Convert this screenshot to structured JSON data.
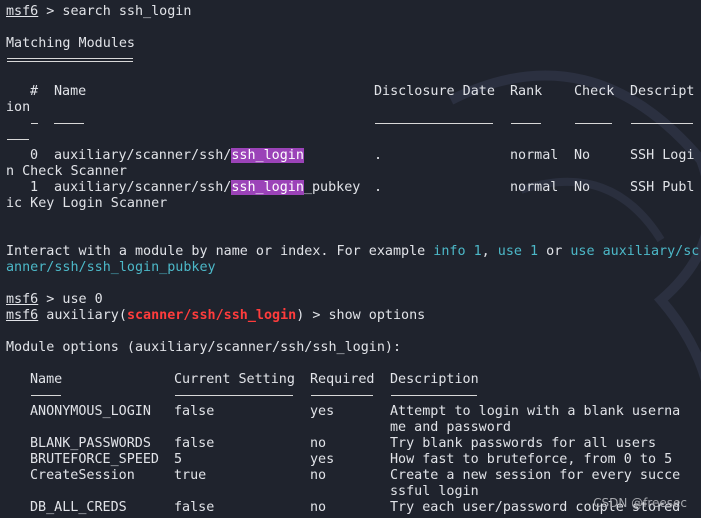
{
  "prompt": "msf6",
  "cmd1": " > search ssh_login",
  "section_matching": "Matching Modules",
  "section_rule": "================",
  "table1": {
    "hdr_idx": "#",
    "hdr_name": "Name",
    "hdr_date": "Disclosure Date",
    "hdr_rank": "Rank",
    "hdr_check": "Check",
    "hdr_desc": "Descript",
    "hdr_desc_wrap": "ion",
    "dash1": "-",
    "dash_wrap": "---",
    "rows": [
      {
        "idx": "0",
        "pre": "auxiliary/scanner/ssh/",
        "hl": "ssh_login",
        "post": "",
        "date": ".",
        "rank": "normal",
        "check": "No",
        "desc": "SSH Logi",
        "desc_wrap": "n Check Scanner"
      },
      {
        "idx": "1",
        "pre": "auxiliary/scanner/ssh/",
        "hl": "ssh_login",
        "post": "_pubkey",
        "date": ".",
        "rank": "normal",
        "check": "No",
        "desc": "SSH Publ",
        "desc_wrap": "ic Key Login Scanner"
      }
    ]
  },
  "interact": {
    "a": "Interact with a module by name or index. For example ",
    "b": "info 1",
    "c": ", ",
    "d": "use 1",
    "e": " or ",
    "f": "use auxiliary/sc",
    "g": "anner/ssh/ssh_login_pubkey"
  },
  "cmd2": " > use 0",
  "prompt_mod_pre": " auxiliary(",
  "prompt_mod_name": "scanner/ssh/ssh_login",
  "prompt_mod_post": ") > show options",
  "options_title": "Module options (auxiliary/scanner/ssh/ssh_login):",
  "table2": {
    "hdr_name": "Name",
    "hdr_setting": "Current Setting",
    "hdr_required": "Required",
    "hdr_desc": "Description",
    "rows": [
      {
        "name": "ANONYMOUS_LOGIN",
        "setting": "false",
        "req": "yes",
        "desc": "Attempt to login with a blank userna",
        "desc2": "me and password"
      },
      {
        "name": "BLANK_PASSWORDS",
        "setting": "false",
        "req": "no",
        "desc": "Try blank passwords for all users",
        "desc2": ""
      },
      {
        "name": "BRUTEFORCE_SPEED",
        "setting": "5",
        "req": "yes",
        "desc": "How fast to bruteforce, from 0 to 5",
        "desc2": ""
      },
      {
        "name": "CreateSession",
        "setting": "true",
        "req": "no",
        "desc": "Create a new session for every succe",
        "desc2": "ssful login"
      },
      {
        "name": "DB_ALL_CREDS",
        "setting": "false",
        "req": "no",
        "desc": "Try each user/password couple stored",
        "desc2": ""
      }
    ]
  },
  "watermark": "CSDN @freesec"
}
